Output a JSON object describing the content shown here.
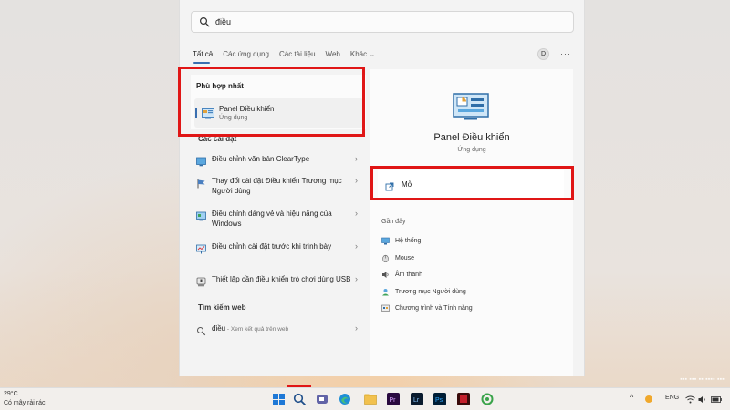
{
  "search": {
    "query": "điều"
  },
  "tabs": [
    {
      "label": "Tất cả"
    },
    {
      "label": "Các ứng dụng"
    },
    {
      "label": "Các tài liệu"
    },
    {
      "label": "Web"
    },
    {
      "label": "Khác"
    }
  ],
  "account": {
    "avatar_letter": "D",
    "more_label": "···"
  },
  "best_match": {
    "heading": "Phù hợp nhất",
    "title": "Panel Điều khiển",
    "subtitle": "Ứng dụng"
  },
  "settings_section": {
    "heading": "Các cài đặt",
    "items": [
      {
        "label": "Điều chỉnh văn bản ClearType",
        "icon": "cleartype-icon"
      },
      {
        "label": "Thay đổi cài đặt Điều khiển Trương mục Người dùng",
        "icon": "uac-flag-icon"
      },
      {
        "label": "Điều chỉnh dáng vẻ và hiệu năng của Windows",
        "icon": "performance-icon"
      },
      {
        "label": "Điều chỉnh cài đặt trước khi trình bày",
        "icon": "presentation-icon"
      },
      {
        "label": "Thiết lập cần điều khiển trò chơi dùng USB",
        "icon": "gamepad-icon"
      }
    ]
  },
  "web_section": {
    "heading": "Tìm kiếm web",
    "query": "điều",
    "suffix": " - Xem kết quả trên web"
  },
  "detail": {
    "title": "Panel Điều khiển",
    "subtitle": "Ứng dụng",
    "open_label": "Mở",
    "recent_heading": "Gần đây",
    "recent_items": [
      {
        "label": "Hệ thống",
        "icon": "system-icon"
      },
      {
        "label": "Mouse",
        "icon": "mouse-icon"
      },
      {
        "label": "Âm thanh",
        "icon": "sound-icon"
      },
      {
        "label": "Trương mục Người dùng",
        "icon": "user-accounts-icon"
      },
      {
        "label": "Chương trình và Tính năng",
        "icon": "programs-icon"
      }
    ]
  },
  "taskbar": {
    "weather_temp": "29°C",
    "weather_desc": "Có mây rải rác",
    "language": "ENG"
  },
  "colors": {
    "accent": "#3a6fb0",
    "highlight_red": "#e01616"
  }
}
